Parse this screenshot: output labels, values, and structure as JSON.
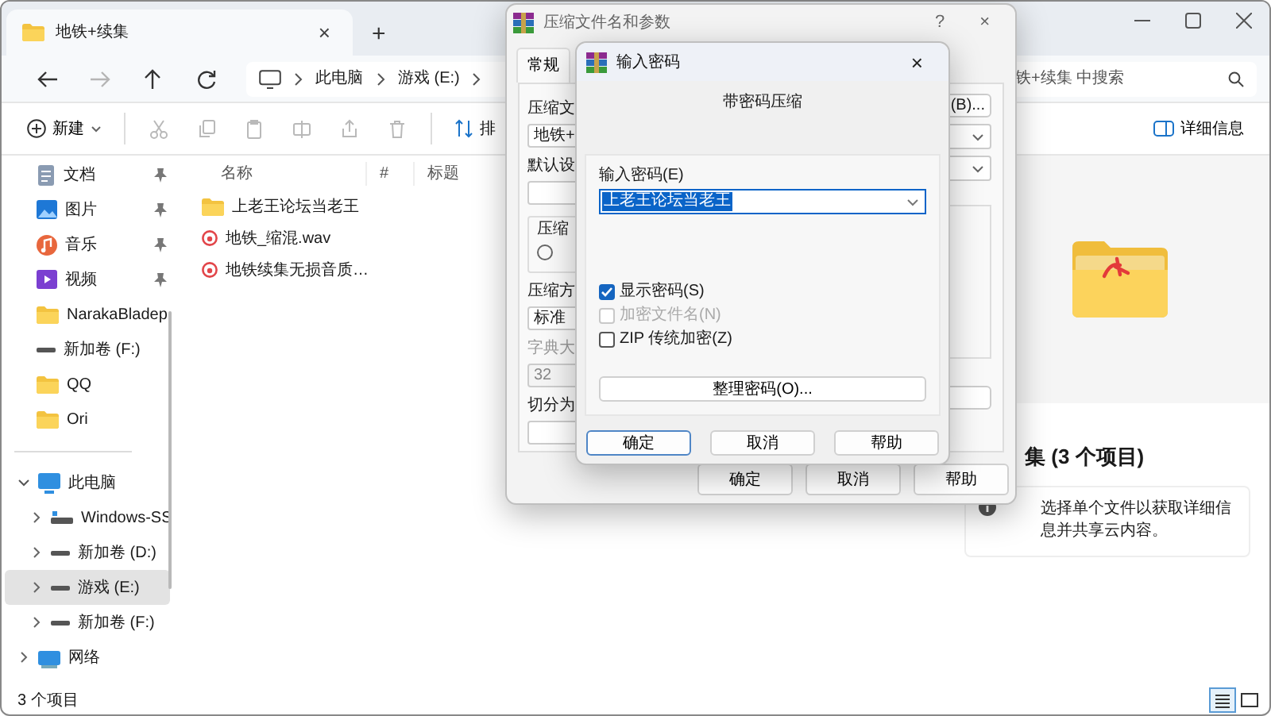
{
  "explorer": {
    "tab": {
      "title": "地铁+续集",
      "close": "×"
    },
    "new_tab": "+",
    "nav_buttons": [
      {
        "kind": "back",
        "disabled": false
      },
      {
        "kind": "forward",
        "disabled": true
      },
      {
        "kind": "up",
        "disabled": false
      },
      {
        "kind": "refresh",
        "disabled": false
      }
    ],
    "breadcrumb": [
      "此电脑",
      "游戏 (E:)"
    ],
    "search": {
      "placeholder": "铁+续集 中搜索"
    },
    "toolbar": {
      "new_label": "新建",
      "sort_label": "排",
      "details_label": "详细信息"
    },
    "sidebar": {
      "pinned": [
        {
          "label": "文档",
          "pinned": true,
          "selected": false
        },
        {
          "label": "图片",
          "pinned": true,
          "selected": false
        },
        {
          "label": "音乐",
          "pinned": true,
          "selected": false
        },
        {
          "label": "视频",
          "pinned": true,
          "selected": false
        },
        {
          "label": "NarakaBladep",
          "pinned": false,
          "selected": false
        },
        {
          "label": "新加卷 (F:)",
          "pinned": false,
          "selected": false
        },
        {
          "label": "QQ",
          "pinned": false,
          "selected": false
        },
        {
          "label": "Ori",
          "pinned": false,
          "selected": false
        }
      ],
      "tree": [
        {
          "label": "此电脑",
          "expanded": true,
          "selected": false,
          "children": [
            {
              "label": "Windows-SS",
              "expanded": false,
              "selected": false
            },
            {
              "label": "新加卷 (D:)",
              "expanded": false,
              "selected": false
            },
            {
              "label": "游戏 (E:)",
              "expanded": false,
              "selected": true
            },
            {
              "label": "新加卷 (F:)",
              "expanded": false,
              "selected": false
            }
          ]
        },
        {
          "label": "网络",
          "expanded": false,
          "selected": false
        }
      ]
    },
    "file_list": {
      "columns": [
        "名称",
        "#",
        "标题"
      ],
      "rows": [
        {
          "name": "上老王论坛当老王",
          "kind": "folder"
        },
        {
          "name": "地铁_缩混.wav",
          "kind": "audio"
        },
        {
          "name": "地铁续集无损音质…",
          "kind": "audio"
        }
      ]
    },
    "details_pane": {
      "title": "集 (3 个项目)",
      "info": "选择单个文件以获取详细信息并共享云内容。"
    },
    "status_bar": {
      "count": "3 个项目",
      "views": [
        {
          "kind": "details",
          "selected": true
        },
        {
          "kind": "tiles",
          "selected": false
        }
      ]
    }
  },
  "archive_dialog": {
    "title": "压缩文件名和参数",
    "help": "?",
    "close": "×",
    "tabs": [
      {
        "label": "常规",
        "selected": true
      }
    ],
    "left_items": [
      {
        "kind": "label",
        "text": "压缩文"
      },
      {
        "kind": "field",
        "text": "地铁+"
      },
      {
        "kind": "label",
        "text": "默认设"
      },
      {
        "kind": "field"
      },
      {
        "kind": "group",
        "text": "压缩",
        "radio_checked": false
      },
      {
        "kind": "label",
        "text": "压缩方"
      },
      {
        "kind": "field",
        "text": "标准"
      },
      {
        "kind": "label",
        "text": "字典大",
        "disabled": true
      },
      {
        "kind": "field",
        "text": "32",
        "disabled": true
      },
      {
        "kind": "label",
        "text": "切分为"
      },
      {
        "kind": "field"
      }
    ],
    "right_items": [
      {
        "kind": "button",
        "text": "(B)..."
      },
      {
        "kind": "dropdown"
      },
      {
        "kind": "dropdown"
      },
      {
        "kind": "group"
      },
      {
        "kind": "field"
      }
    ],
    "buttons": [
      "确定",
      "取消",
      "帮助"
    ]
  },
  "password_dialog": {
    "title": "输入密码",
    "close": "×",
    "heading": "带密码压缩",
    "password_label": "输入密码(E)",
    "password": "上老王论坛当老王",
    "options": [
      {
        "label": "显示密码(S)",
        "checked": true,
        "disabled": false
      },
      {
        "label": "加密文件名(N)",
        "checked": false,
        "disabled": true
      },
      {
        "label": "ZIP 传统加密(Z)",
        "checked": false,
        "disabled": false
      }
    ],
    "organize_button": "整理密码(O)...",
    "buttons": [
      {
        "label": "确定",
        "default": true
      },
      {
        "label": "取消",
        "default": false
      },
      {
        "label": "帮助",
        "default": false
      }
    ]
  }
}
